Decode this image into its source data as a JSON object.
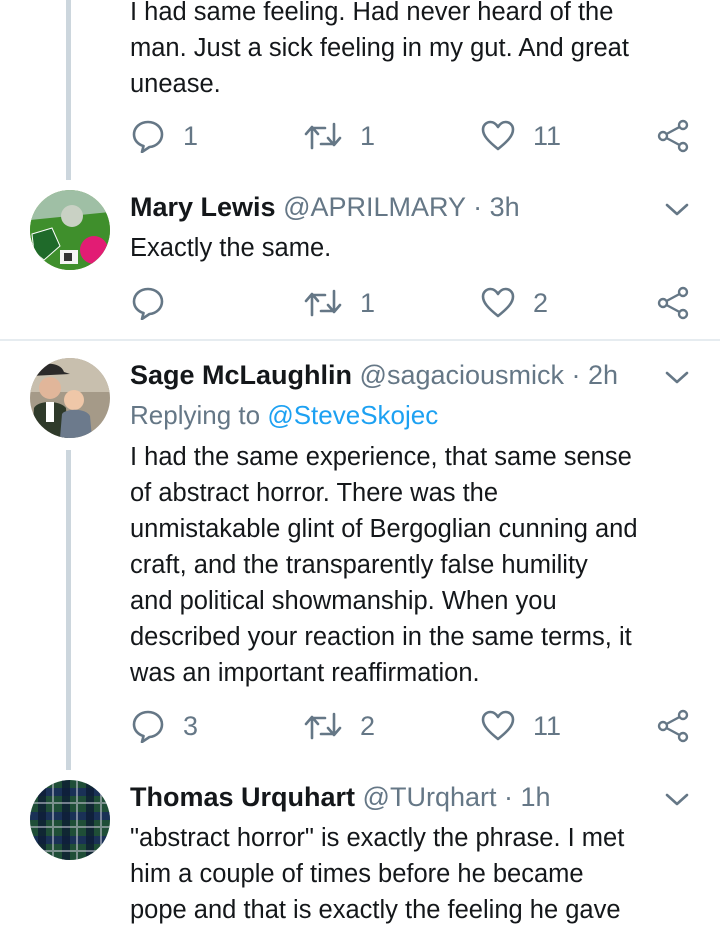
{
  "tweets": [
    {
      "text_lines": [
        "I had same feeling.  Had never heard of the",
        "man.  Just a sick feeling in my gut.  And great",
        "unease."
      ],
      "counts": {
        "reply": "1",
        "retweet": "1",
        "like": "11"
      }
    },
    {
      "name": "Mary Lewis",
      "handle": "@APRILMARY",
      "time": "· 3h",
      "text": "Exactly the same.",
      "counts": {
        "reply": "",
        "retweet": "1",
        "like": "2"
      }
    },
    {
      "name": "Sage McLaughlin",
      "handle": "@sagaciousmick",
      "time": "· 2h",
      "replying_label": "Replying to",
      "replying_handle": "@SteveSkojec",
      "text_lines": [
        "I had the same experience, that same sense",
        "of abstract horror. There was the",
        "unmistakable glint of Bergoglian cunning and",
        "craft, and the transparently false humility",
        "and political showmanship. When you",
        "described your reaction in the same terms, it",
        "was an important reaffirmation."
      ],
      "counts": {
        "reply": "3",
        "retweet": "2",
        "like": "11"
      }
    },
    {
      "name": "Thomas Urquhart",
      "handle": "@TUrqhart",
      "time": "· 1h",
      "text_lines": [
        "\"abstract horror\" is exactly the phrase. I met",
        "him a couple of times before he became",
        "pope and that is exactly the feeling he gave"
      ]
    }
  ],
  "icons": [
    "reply-icon",
    "retweet-icon",
    "like-icon",
    "share-icon",
    "chevron-down-icon"
  ],
  "colors": {
    "secondary": "#657786",
    "link": "#1da1f2",
    "thread_line": "#ccd6dd",
    "divider": "#e6ecf0"
  }
}
